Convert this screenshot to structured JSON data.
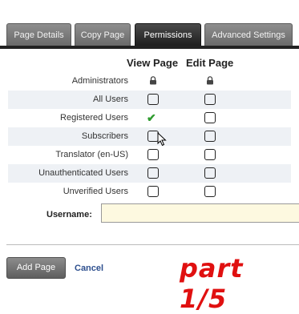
{
  "tabs": [
    "Page Details",
    "Copy Page",
    "Permissions",
    "Advanced Settings"
  ],
  "active_tab": "Permissions",
  "grid": {
    "col_view": "View Page",
    "col_edit": "Edit Page",
    "rows": [
      {
        "label": "Administrators",
        "view": "locked",
        "edit": "locked"
      },
      {
        "label": "All Users",
        "view": "unchecked",
        "edit": "unchecked"
      },
      {
        "label": "Registered Users",
        "view": "checked",
        "edit": "unchecked"
      },
      {
        "label": "Subscribers",
        "view": "unchecked",
        "edit": "unchecked"
      },
      {
        "label": "Translator (en-US)",
        "view": "unchecked",
        "edit": "unchecked"
      },
      {
        "label": "Unauthenticated Users",
        "view": "unchecked",
        "edit": "unchecked"
      },
      {
        "label": "Unverified Users",
        "view": "unchecked",
        "edit": "unchecked"
      }
    ]
  },
  "username": {
    "label": "Username:",
    "value": ""
  },
  "actions": {
    "add_label": "Add Page",
    "cancel_label": "Cancel"
  },
  "overlay_text": "part 1/5",
  "colors": {
    "check": "#2e9b2e",
    "overlay": "#e01010",
    "link": "#2d4f8e"
  }
}
